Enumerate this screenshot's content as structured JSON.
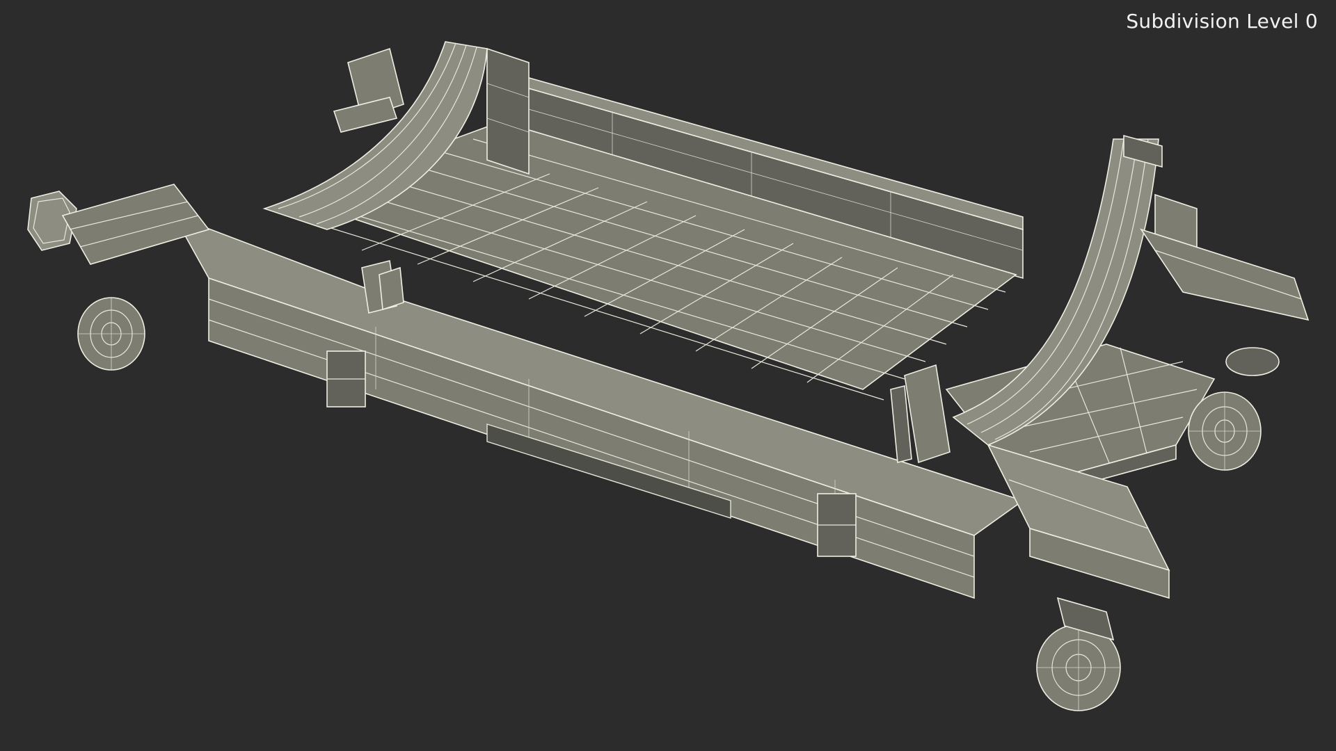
{
  "viewport": {
    "background": "#2c2c2c",
    "overlay_label": "Subdivision Level 0"
  },
  "model": {
    "wire_color": "#eeeee2",
    "surface_color": "#7d7d72"
  }
}
